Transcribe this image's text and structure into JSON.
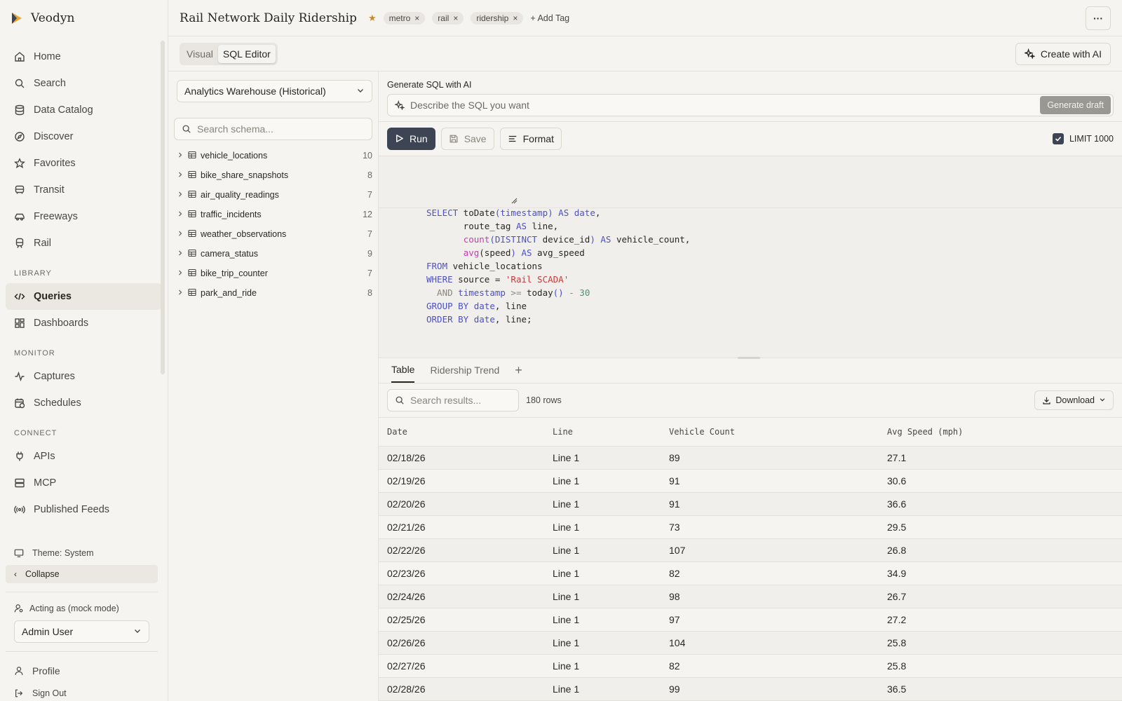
{
  "app": {
    "name": "Veodyn"
  },
  "sidebar": {
    "nav": [
      {
        "label": "Home",
        "icon": "home-icon"
      },
      {
        "label": "Search",
        "icon": "search-icon"
      },
      {
        "label": "Data Catalog",
        "icon": "database-icon"
      },
      {
        "label": "Discover",
        "icon": "compass-icon"
      },
      {
        "label": "Favorites",
        "icon": "star-icon"
      },
      {
        "label": "Transit",
        "icon": "bus-icon"
      },
      {
        "label": "Freeways",
        "icon": "car-icon"
      },
      {
        "label": "Rail",
        "icon": "train-icon"
      }
    ],
    "library_label": "LIBRARY",
    "library": [
      {
        "label": "Queries",
        "icon": "code-icon",
        "active": true
      },
      {
        "label": "Dashboards",
        "icon": "grid-icon"
      }
    ],
    "monitor_label": "MONITOR",
    "monitor": [
      {
        "label": "Captures",
        "icon": "activity-icon"
      },
      {
        "label": "Schedules",
        "icon": "calendar-clock-icon"
      }
    ],
    "connect_label": "CONNECT",
    "connect": [
      {
        "label": "APIs",
        "icon": "plug-icon"
      },
      {
        "label": "MCP",
        "icon": "server-icon"
      },
      {
        "label": "Published Feeds",
        "icon": "broadcast-icon"
      }
    ],
    "theme": "Theme: System",
    "collapse": "Collapse",
    "acting_as": "Acting as (mock mode)",
    "user": "Admin User",
    "profile": "Profile",
    "sign_out": "Sign Out"
  },
  "header": {
    "title": "Rail Network Daily Ridership",
    "tags": [
      "metro",
      "rail",
      "ridership"
    ],
    "add_tag": "+ Add Tag",
    "more": "···"
  },
  "mode": {
    "visual": "Visual",
    "sql": "SQL Editor",
    "create_ai": "Create with AI"
  },
  "schema": {
    "datasource": "Analytics Warehouse (Historical)",
    "search_placeholder": "Search schema...",
    "tables": [
      {
        "name": "vehicle_locations",
        "count": "10"
      },
      {
        "name": "bike_share_snapshots",
        "count": "8"
      },
      {
        "name": "air_quality_readings",
        "count": "7"
      },
      {
        "name": "traffic_incidents",
        "count": "12"
      },
      {
        "name": "weather_observations",
        "count": "7"
      },
      {
        "name": "camera_status",
        "count": "9"
      },
      {
        "name": "bike_trip_counter",
        "count": "7"
      },
      {
        "name": "park_and_ride",
        "count": "8"
      }
    ]
  },
  "generate": {
    "label": "Generate SQL with AI",
    "placeholder": "Describe the SQL you want",
    "button": "Generate draft"
  },
  "toolbar": {
    "run": "Run",
    "save": "Save",
    "format": "Format",
    "limit": "LIMIT 1000"
  },
  "sql": {
    "l1a": "SELECT",
    "l1b": " toDate",
    "l1c": "(timestamp)",
    "l1d": " AS",
    "l1e": " date",
    "l1f": ",",
    "l2a": "       route_tag ",
    "l2b": "AS",
    "l2c": " line,",
    "l3a": "       ",
    "l3b": "count",
    "l3c": "(DISTINCT",
    "l3d": " device_id",
    "l3e": ")",
    "l3f": " AS",
    "l3g": " vehicle_count,",
    "l4a": "       ",
    "l4b": "avg",
    "l4c": "(speed",
    "l4d": ")",
    "l4e": " AS",
    "l4f": " avg_speed",
    "l5a": "FROM",
    "l5b": " vehicle_locations",
    "l6a": "WHERE",
    "l6b": " source = ",
    "l6c": "'Rail SCADA'",
    "l7a": "  AND",
    "l7b": " timestamp",
    "l7c": " >=",
    "l7d": " today",
    "l7e": "()",
    "l7f": " -",
    "l7g": " 30",
    "l8a": "GROUP BY",
    "l8b": " date",
    "l8c": ", line",
    "l9a": "ORDER BY",
    "l9b": " date",
    "l9c": ", line;"
  },
  "results": {
    "tabs": [
      "Table",
      "Ridership Trend"
    ],
    "add_tab": "+",
    "search_placeholder": "Search results...",
    "row_count": "180 rows",
    "download": "Download",
    "columns": [
      "Date",
      "Line",
      "Vehicle Count",
      "Avg Speed (mph)"
    ],
    "rows": [
      [
        "02/18/26",
        "Line 1",
        "89",
        "27.1"
      ],
      [
        "02/19/26",
        "Line 1",
        "91",
        "30.6"
      ],
      [
        "02/20/26",
        "Line 1",
        "91",
        "36.6"
      ],
      [
        "02/21/26",
        "Line 1",
        "73",
        "29.5"
      ],
      [
        "02/22/26",
        "Line 1",
        "107",
        "26.8"
      ],
      [
        "02/23/26",
        "Line 1",
        "82",
        "34.9"
      ],
      [
        "02/24/26",
        "Line 1",
        "98",
        "26.7"
      ],
      [
        "02/25/26",
        "Line 1",
        "97",
        "27.2"
      ],
      [
        "02/26/26",
        "Line 1",
        "104",
        "25.8"
      ],
      [
        "02/27/26",
        "Line 1",
        "82",
        "25.8"
      ],
      [
        "02/28/26",
        "Line 1",
        "99",
        "36.5"
      ]
    ]
  }
}
